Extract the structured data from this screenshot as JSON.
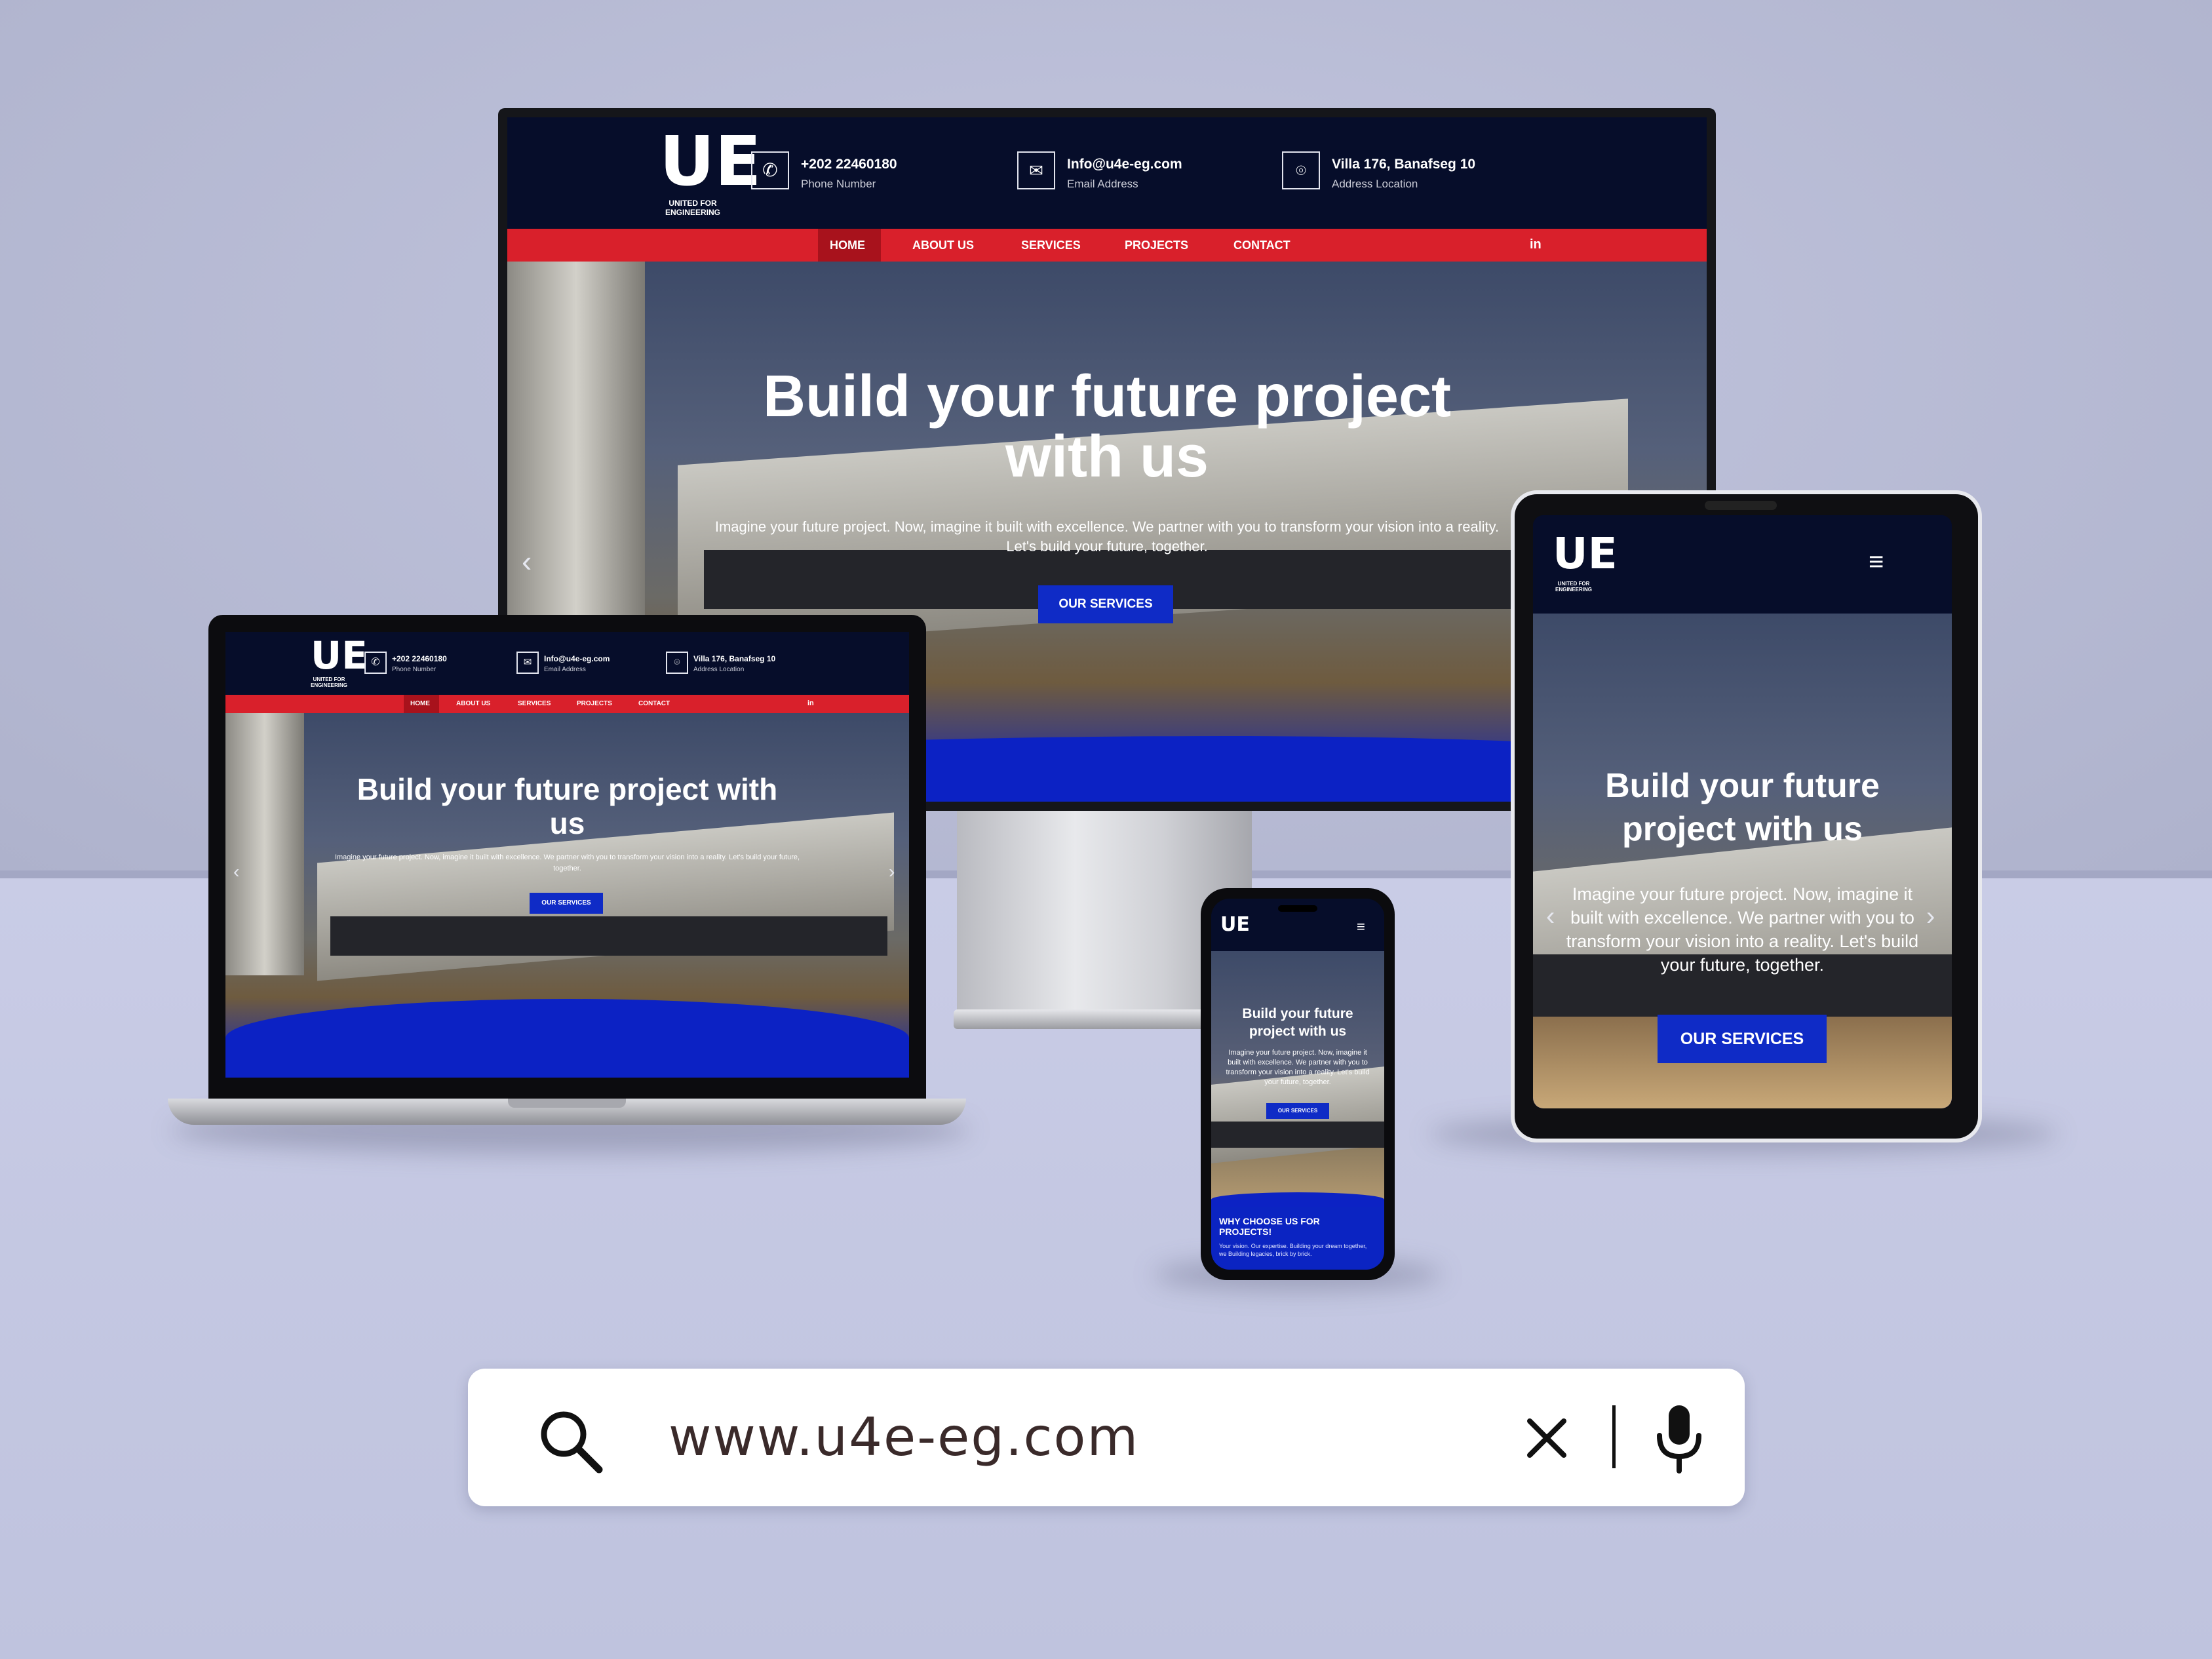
{
  "brand": {
    "logo_letters": "UE",
    "logo_name": "UNITED FOR ENGINEERING"
  },
  "contact": {
    "phone": "+202 22460180",
    "phone_label": "Phone Number",
    "email": "Info@u4e-eg.com",
    "email_label": "Email Address",
    "address": "Villa 176, Banafseg 10",
    "address_label": "Address Location"
  },
  "nav": {
    "home": "HOME",
    "about": "ABOUT US",
    "services": "SERVICES",
    "projects": "PROJECTS",
    "contact": "CONTACT",
    "social_icon": "linkedin-icon"
  },
  "hero": {
    "title": "Build your future project with us",
    "subtitle": "Imagine your future project. Now, imagine it built with excellence. We partner with you to transform your vision into a reality. Let's build your future, together.",
    "cta": "OUR SERVICES"
  },
  "phone_section": {
    "heading": "WHY CHOOSE US FOR PROJECTS!",
    "text": "Your vision. Our expertise. Building your dream together, we Building legacies, brick by brick."
  },
  "search": {
    "value": "www.u4e-eg.com",
    "search_icon": "search-icon",
    "clear_icon": "close-icon",
    "mic_icon": "microphone-icon"
  },
  "colors": {
    "header_bg": "#060d2a",
    "nav_red": "#d9202b",
    "accent_blue": "#0f2bc6",
    "background": "#b9bdd8"
  }
}
